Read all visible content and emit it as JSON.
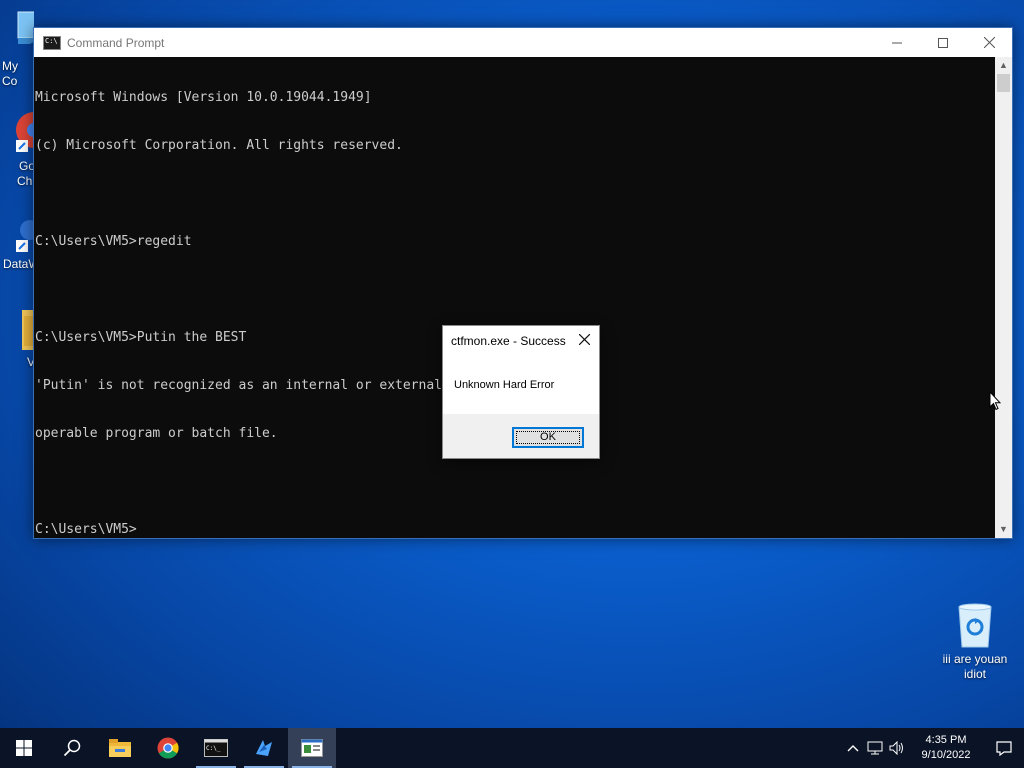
{
  "desktop": {
    "icons_left": [
      {
        "label": "My Co",
        "icon": "computer-icon"
      },
      {
        "label": "Go",
        "label2": "Ch",
        "icon": "chrome-shortcut-icon"
      },
      {
        "label": "DataW",
        "icon": "app-shortcut-icon"
      },
      {
        "label": "V",
        "icon": "folder-icon"
      }
    ],
    "recycle_bin": {
      "label": "iii are youan idiot",
      "icon": "recycle-bin-icon"
    }
  },
  "cmd_window": {
    "title": "Command Prompt",
    "lines": [
      "Microsoft Windows [Version 10.0.19044.1949]",
      "(c) Microsoft Corporation. All rights reserved.",
      "",
      "C:\\Users\\VM5>regedit",
      "",
      "C:\\Users\\VM5>Putin the BEST",
      "'Putin' is not recognized as an internal or external command,",
      "operable program or batch file.",
      "",
      "C:\\Users\\VM5>"
    ]
  },
  "message_box": {
    "title": "ctfmon.exe - Success",
    "text": "Unknown Hard Error",
    "ok_label": "OK"
  },
  "taskbar": {
    "apps": [
      "start-icon",
      "search-icon",
      "file-explorer-icon",
      "chrome-icon",
      "command-prompt-icon",
      "app-icon",
      "message-box-icon"
    ],
    "time": "4:35 PM",
    "date": "9/10/2022"
  },
  "colors": {
    "accent": "#0078d7",
    "console_bg": "#0c0c0c",
    "console_text": "#cccccc",
    "taskbar_bg": "#0b1426"
  }
}
